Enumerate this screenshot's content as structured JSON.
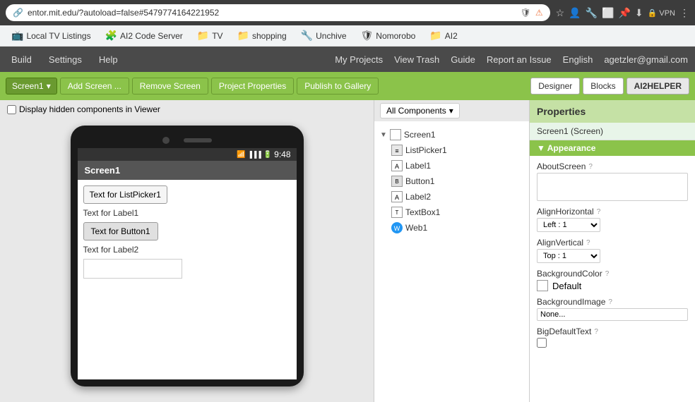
{
  "browser": {
    "url": "entor.mit.edu/?autoload=false#5479774164221952",
    "shield_icon": "🛡",
    "warning_icon": "⚠"
  },
  "bookmarks": [
    {
      "label": "Local TV Listings",
      "icon": "📺"
    },
    {
      "label": "AI2 Code Server",
      "icon": "🧩"
    },
    {
      "label": "TV",
      "icon": "📁"
    },
    {
      "label": "shopping",
      "icon": "📁"
    },
    {
      "label": "Unchive",
      "icon": "🔧"
    },
    {
      "label": "Nomorobo",
      "icon": "🛡"
    },
    {
      "label": "AI2",
      "icon": "📁"
    }
  ],
  "appnav": {
    "build_label": "Build",
    "settings_label": "Settings",
    "help_label": "Help",
    "my_projects_label": "My Projects",
    "view_trash_label": "View Trash",
    "guide_label": "Guide",
    "report_issue_label": "Report an Issue",
    "english_label": "English",
    "user_label": "agetzler@gmail.com"
  },
  "toolbar": {
    "screen_label": "Screen1",
    "add_screen_label": "Add Screen ...",
    "remove_screen_label": "Remove Screen",
    "project_properties_label": "Project Properties",
    "publish_label": "Publish to Gallery",
    "designer_label": "Designer",
    "blocks_label": "Blocks",
    "ai2helper_label": "AI2HELPER"
  },
  "viewer": {
    "checkbox_label": "Display hidden components in Viewer",
    "phone": {
      "time": "9:48",
      "screen_title": "Screen1",
      "listpicker_text": "Text for ListPicker1",
      "label1_text": "Text for Label1",
      "button_text": "Text for Button1",
      "label2_text": "Text for Label2"
    }
  },
  "components": {
    "dropdown_label": "All Components",
    "tree": [
      {
        "id": "Screen1",
        "label": "Screen1",
        "type": "screen",
        "indent": 0,
        "expanded": true,
        "selected": false
      },
      {
        "id": "ListPicker1",
        "label": "ListPicker1",
        "type": "listpicker",
        "indent": 1,
        "selected": false
      },
      {
        "id": "Label1",
        "label": "Label1",
        "type": "label",
        "indent": 1,
        "selected": false
      },
      {
        "id": "Button1",
        "label": "Button1",
        "type": "button",
        "indent": 1,
        "selected": false
      },
      {
        "id": "Label2",
        "label": "Label2",
        "type": "label",
        "indent": 1,
        "selected": false
      },
      {
        "id": "TextBox1",
        "label": "TextBox1",
        "type": "textbox",
        "indent": 1,
        "selected": false
      },
      {
        "id": "Web1",
        "label": "Web1",
        "type": "web",
        "indent": 1,
        "selected": false
      }
    ]
  },
  "properties": {
    "header": "Properties",
    "screen_label": "Screen1 (Screen)",
    "appearance_label": "▼ Appearance",
    "props": [
      {
        "id": "AboutScreen",
        "label": "AboutScreen",
        "type": "textarea",
        "value": ""
      },
      {
        "id": "AlignHorizontal",
        "label": "AlignHorizontal",
        "type": "select",
        "value": "Left : 1"
      },
      {
        "id": "AlignVertical",
        "label": "AlignVertical",
        "type": "select",
        "value": "Top : 1"
      },
      {
        "id": "BackgroundColor",
        "label": "BackgroundColor",
        "type": "color",
        "value": "Default"
      },
      {
        "id": "BackgroundImage",
        "label": "BackgroundImage",
        "type": "input",
        "value": "None..."
      },
      {
        "id": "BigDefaultText",
        "label": "BigDefaultText",
        "type": "checkbox",
        "value": false
      }
    ]
  }
}
